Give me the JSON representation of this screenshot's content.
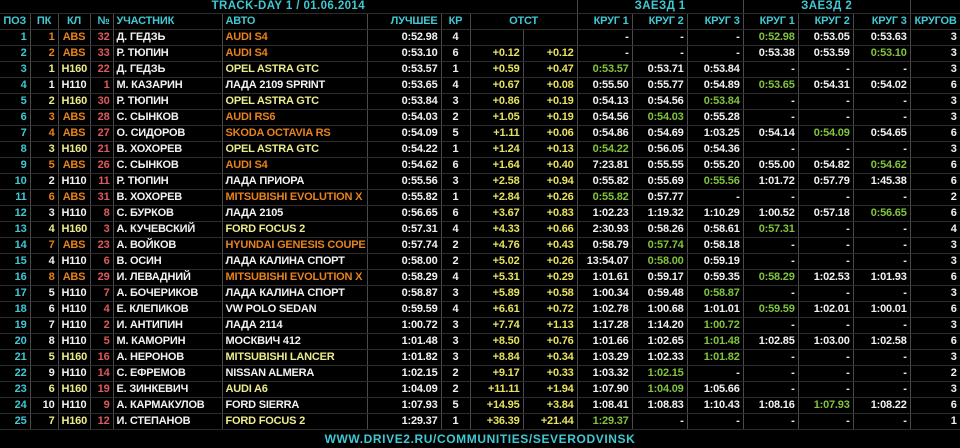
{
  "title": "TRACK-DAY 1 / 01.06.2014",
  "footer": {
    "url": "WWW.DRIVE2.RU/COMMUNITIES/SEVERODVINSK"
  },
  "colors": {
    "bg": "#000000",
    "cyan": "#3fc9d4",
    "white": "#f2f2f2",
    "red": "#de5b5b",
    "green": "#82c43c",
    "gapyellow": "#e8e25c",
    "gridv": "#4a4a4a",
    "gridh": "#2d2d2d"
  },
  "class_colors": {
    "ABS": "#e8821c",
    "Н160": "#edec8a",
    "Н110": "#f2f2f2"
  },
  "table": {
    "heat1_label": "ЗАЕЗД 1",
    "heat2_label": "ЗАЕЗД 2",
    "columns": [
      {
        "key": "pos",
        "label": "ПОЗ",
        "align": "center"
      },
      {
        "key": "pk",
        "label": "ПК",
        "align": "center"
      },
      {
        "key": "cls",
        "label": "КЛ",
        "align": "center"
      },
      {
        "key": "num",
        "label": "№",
        "align": "right"
      },
      {
        "key": "driver",
        "label": "УЧАСТНИК",
        "align": "left"
      },
      {
        "key": "car",
        "label": "АВТО",
        "align": "left"
      },
      {
        "key": "best",
        "label": "ЛУЧШЕЕ",
        "align": "right"
      },
      {
        "key": "kr",
        "label": "КР",
        "align": "center"
      },
      {
        "key": "otst",
        "label": "ОТСТ",
        "align": "center",
        "colspan": 2
      },
      {
        "key": "s1k1",
        "label": "КРУГ 1",
        "align": "right"
      },
      {
        "key": "s1k2",
        "label": "КРУГ 2",
        "align": "right"
      },
      {
        "key": "s1k3",
        "label": "КРУГ 3",
        "align": "right"
      },
      {
        "key": "s2k1",
        "label": "КРУГ 1",
        "align": "right"
      },
      {
        "key": "s2k2",
        "label": "КРУГ 2",
        "align": "right"
      },
      {
        "key": "s2k3",
        "label": "КРУГ 3",
        "align": "right"
      },
      {
        "key": "total",
        "label": "КРУГОВ",
        "align": "right"
      }
    ],
    "rows": [
      {
        "pos": "1",
        "pk": "1",
        "cls": "ABS",
        "num": "32",
        "driver": "Д. ГЕДЗЬ",
        "car": "AUDI S4",
        "best": "0:52.98",
        "kr": "4",
        "gap": "",
        "int": "",
        "laps": [
          "-",
          "-",
          "-",
          "0:52.98",
          "0:53.05",
          "0:53.63"
        ],
        "best_lap": 3,
        "total": "3"
      },
      {
        "pos": "2",
        "pk": "2",
        "cls": "ABS",
        "num": "33",
        "driver": "Р. ТЮПИН",
        "car": "AUDI S4",
        "best": "0:53.10",
        "kr": "6",
        "gap": "+0.12",
        "int": "+0.12",
        "laps": [
          "-",
          "-",
          "-",
          "0:53.38",
          "0:53.59",
          "0:53.10"
        ],
        "best_lap": 5,
        "total": "3"
      },
      {
        "pos": "3",
        "pk": "1",
        "cls": "Н160",
        "num": "22",
        "driver": "Д. ГЕДЗЬ",
        "car": "OPEL ASTRA GTC",
        "best": "0:53.57",
        "kr": "1",
        "gap": "+0.59",
        "int": "+0.47",
        "laps": [
          "0:53.57",
          "0:53.71",
          "0:53.84",
          "-",
          "-",
          "-"
        ],
        "best_lap": 0,
        "total": "3"
      },
      {
        "pos": "4",
        "pk": "1",
        "cls": "Н110",
        "num": "1",
        "driver": "М. КАЗАРИН",
        "car": "ЛАДА 2109 SPRINT",
        "best": "0:53.65",
        "kr": "4",
        "gap": "+0.67",
        "int": "+0.08",
        "laps": [
          "0:55.50",
          "0:55.77",
          "0:54.89",
          "0:53.65",
          "0:54.31",
          "0:54.02"
        ],
        "best_lap": 3,
        "total": "6"
      },
      {
        "pos": "5",
        "pk": "2",
        "cls": "Н160",
        "num": "30",
        "driver": "Р. ТЮПИН",
        "car": "OPEL ASTRA GTC",
        "best": "0:53.84",
        "kr": "3",
        "gap": "+0.86",
        "int": "+0.19",
        "laps": [
          "0:54.13",
          "0:54.56",
          "0:53.84",
          "-",
          "-",
          "-"
        ],
        "best_lap": 2,
        "total": "3"
      },
      {
        "pos": "6",
        "pk": "3",
        "cls": "ABS",
        "num": "28",
        "driver": "С. СЫНКОВ",
        "car": "AUDI RS6",
        "best": "0:54.03",
        "kr": "2",
        "gap": "+1.05",
        "int": "+0.19",
        "laps": [
          "0:54.56",
          "0:54.03",
          "0:55.28",
          "-",
          "-",
          "-"
        ],
        "best_lap": 1,
        "total": "3"
      },
      {
        "pos": "7",
        "pk": "4",
        "cls": "ABS",
        "num": "27",
        "driver": "О. СИДОРОВ",
        "car": "SKODA OCTAVIA RS",
        "best": "0:54.09",
        "kr": "5",
        "gap": "+1.11",
        "int": "+0.06",
        "laps": [
          "0:54.86",
          "0:54.69",
          "1:03.25",
          "0:54.14",
          "0:54.09",
          "0:54.65"
        ],
        "best_lap": 4,
        "total": "6"
      },
      {
        "pos": "8",
        "pk": "3",
        "cls": "Н160",
        "num": "21",
        "driver": "В. ХОХОРЕВ",
        "car": "OPEL ASTRA GTC",
        "best": "0:54.22",
        "kr": "1",
        "gap": "+1.24",
        "int": "+0.13",
        "laps": [
          "0:54.22",
          "0:56.05",
          "0:54.36",
          "-",
          "-",
          "-"
        ],
        "best_lap": 0,
        "total": "3"
      },
      {
        "pos": "9",
        "pk": "5",
        "cls": "ABS",
        "num": "26",
        "driver": "С. СЫНКОВ",
        "car": "AUDI S4",
        "best": "0:54.62",
        "kr": "6",
        "gap": "+1.64",
        "int": "+0.40",
        "laps": [
          "7:23.81",
          "0:55.55",
          "0:55.20",
          "0:55.00",
          "0:54.82",
          "0:54.62"
        ],
        "best_lap": 5,
        "total": "6"
      },
      {
        "pos": "10",
        "pk": "2",
        "cls": "Н110",
        "num": "11",
        "driver": "Р. ТЮПИН",
        "car": "ЛАДА ПРИОРА",
        "best": "0:55.56",
        "kr": "3",
        "gap": "+2.58",
        "int": "+0.94",
        "laps": [
          "0:55.82",
          "0:55.69",
          "0:55.56",
          "1:01.72",
          "0:57.79",
          "1:45.38"
        ],
        "best_lap": 2,
        "total": "6"
      },
      {
        "pos": "11",
        "pk": "6",
        "cls": "ABS",
        "num": "31",
        "driver": "В. ХОХОРЕВ",
        "car": "MITSUBISHI EVOLUTION X",
        "best": "0:55.82",
        "kr": "1",
        "gap": "+2.84",
        "int": "+0.26",
        "laps": [
          "0:55.82",
          "0:57.77",
          "-",
          "-",
          "-",
          "-"
        ],
        "best_lap": 0,
        "total": "2"
      },
      {
        "pos": "12",
        "pk": "3",
        "cls": "Н110",
        "num": "8",
        "driver": "С. БУРКОВ",
        "car": "ЛАДА 2105",
        "best": "0:56.65",
        "kr": "6",
        "gap": "+3.67",
        "int": "+0.83",
        "laps": [
          "1:02.23",
          "1:19.32",
          "1:10.29",
          "1:00.52",
          "0:57.18",
          "0:56.65"
        ],
        "best_lap": 5,
        "total": "6"
      },
      {
        "pos": "13",
        "pk": "4",
        "cls": "Н160",
        "num": "3",
        "driver": "А. КУЧЕВСКИЙ",
        "car": "FORD FOCUS 2",
        "best": "0:57.31",
        "kr": "4",
        "gap": "+4.33",
        "int": "+0.66",
        "laps": [
          "2:30.93",
          "0:58.26",
          "0:58.61",
          "0:57.31",
          "-",
          "-"
        ],
        "best_lap": 3,
        "total": "4"
      },
      {
        "pos": "14",
        "pk": "7",
        "cls": "ABS",
        "num": "23",
        "driver": "А. ВОЙКОВ",
        "car": "HYUNDAI GENESIS COUPE",
        "best": "0:57.74",
        "kr": "2",
        "gap": "+4.76",
        "int": "+0.43",
        "laps": [
          "0:58.79",
          "0:57.74",
          "0:58.18",
          "-",
          "-",
          "-"
        ],
        "best_lap": 1,
        "total": "3"
      },
      {
        "pos": "15",
        "pk": "4",
        "cls": "Н110",
        "num": "6",
        "driver": "В. ОСИН",
        "car": "ЛАДА КАЛИНА СПОРТ",
        "best": "0:58.00",
        "kr": "2",
        "gap": "+5.02",
        "int": "+0.26",
        "laps": [
          "13:54.07",
          "0:58.00",
          "0:59.19",
          "-",
          "-",
          "-"
        ],
        "best_lap": 1,
        "total": "3"
      },
      {
        "pos": "16",
        "pk": "8",
        "cls": "ABS",
        "num": "29",
        "driver": "И. ЛЕВАДНИЙ",
        "car": "MITSUBISHI EVOLUTION X",
        "best": "0:58.29",
        "kr": "4",
        "gap": "+5.31",
        "int": "+0.29",
        "laps": [
          "1:01.61",
          "0:59.17",
          "0:59.35",
          "0:58.29",
          "1:02.53",
          "1:01.93"
        ],
        "best_lap": 3,
        "total": "6"
      },
      {
        "pos": "17",
        "pk": "5",
        "cls": "Н110",
        "num": "7",
        "driver": "А. БОЧЕРИКОВ",
        "car": "ЛАДА КАЛИНА СПОРТ",
        "best": "0:58.87",
        "kr": "3",
        "gap": "+5.89",
        "int": "+0.58",
        "laps": [
          "1:00.34",
          "0:59.48",
          "0:58.87",
          "-",
          "-",
          "-"
        ],
        "best_lap": 2,
        "total": "3"
      },
      {
        "pos": "18",
        "pk": "6",
        "cls": "Н110",
        "num": "4",
        "driver": "Е. КЛЕПИКОВ",
        "car": "VW POLO SEDAN",
        "best": "0:59.59",
        "kr": "4",
        "gap": "+6.61",
        "int": "+0.72",
        "laps": [
          "1:02.78",
          "1:00.68",
          "1:01.01",
          "0:59.59",
          "1:02.01",
          "1:00.01"
        ],
        "best_lap": 3,
        "total": "6"
      },
      {
        "pos": "19",
        "pk": "7",
        "cls": "Н110",
        "num": "2",
        "driver": "И. АНТИПИН",
        "car": "ЛАДА 2114",
        "best": "1:00.72",
        "kr": "3",
        "gap": "+7.74",
        "int": "+1.13",
        "laps": [
          "1:17.28",
          "1:14.20",
          "1:00.72",
          "-",
          "-",
          "-"
        ],
        "best_lap": 2,
        "total": "3"
      },
      {
        "pos": "20",
        "pk": "8",
        "cls": "Н110",
        "num": "5",
        "driver": "М. КАМОРИН",
        "car": "МОСКВИЧ 412",
        "best": "1:01.48",
        "kr": "3",
        "gap": "+8.50",
        "int": "+0.76",
        "laps": [
          "1:01.66",
          "1:02.65",
          "1:01.48",
          "1:02.85",
          "1:03.00",
          "1:02.58"
        ],
        "best_lap": 2,
        "total": "6"
      },
      {
        "pos": "21",
        "pk": "5",
        "cls": "Н160",
        "num": "16",
        "driver": "А. НЕРОНОВ",
        "car": "MITSUBISHI LANCER",
        "best": "1:01.82",
        "kr": "3",
        "gap": "+8.84",
        "int": "+0.34",
        "laps": [
          "1:03.29",
          "1:02.33",
          "1:01.82",
          "-",
          "-",
          "-"
        ],
        "best_lap": 2,
        "total": "3"
      },
      {
        "pos": "22",
        "pk": "9",
        "cls": "Н110",
        "num": "14",
        "driver": "С. ЕФРЕМОВ",
        "car": "NISSAN ALMERA",
        "best": "1:02.15",
        "kr": "2",
        "gap": "+9.17",
        "int": "+0.33",
        "laps": [
          "1:03.32",
          "1:02.15",
          "-",
          "-",
          "-",
          "-"
        ],
        "best_lap": 1,
        "total": "2"
      },
      {
        "pos": "23",
        "pk": "6",
        "cls": "Н160",
        "num": "19",
        "driver": "Е. ЗИНКЕВИЧ",
        "car": "AUDI A6",
        "best": "1:04.09",
        "kr": "2",
        "gap": "+11.11",
        "int": "+1.94",
        "laps": [
          "1:07.90",
          "1:04.09",
          "1:05.66",
          "-",
          "-",
          "-"
        ],
        "best_lap": 1,
        "total": "3"
      },
      {
        "pos": "24",
        "pk": "10",
        "cls": "Н110",
        "num": "9",
        "driver": "А. КАРМАКУЛОВ",
        "car": "FORD SIERRA",
        "best": "1:07.93",
        "kr": "5",
        "gap": "+14.95",
        "int": "+3.84",
        "laps": [
          "1:08.41",
          "1:08.83",
          "1:10.43",
          "1:08.16",
          "1:07.93",
          "1:08.22"
        ],
        "best_lap": 4,
        "total": "6"
      },
      {
        "pos": "25",
        "pk": "7",
        "cls": "Н160",
        "num": "12",
        "driver": "И. СТЕПАНОВ",
        "car": "FORD FOCUS 2",
        "best": "1:29.37",
        "kr": "1",
        "gap": "+36.39",
        "int": "+21.44",
        "laps": [
          "1:29.37",
          "-",
          "-",
          "-",
          "-",
          "-"
        ],
        "best_lap": 0,
        "total": "1"
      }
    ]
  }
}
